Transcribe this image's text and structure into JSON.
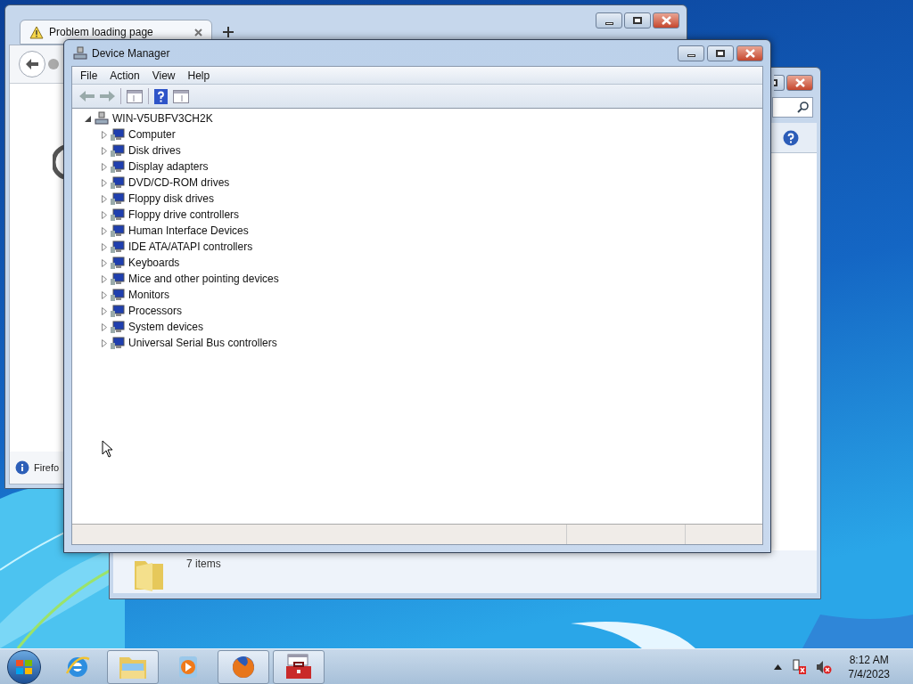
{
  "browser_window": {
    "tab_title": "Problem loading page",
    "status_text": "Firefo"
  },
  "explorer_window": {
    "status_text": "7 items"
  },
  "device_manager": {
    "title": "Device Manager",
    "menu": [
      "File",
      "Action",
      "View",
      "Help"
    ],
    "tree": {
      "label": "WIN-V5UBFV3CH2K",
      "expanded": true,
      "children": [
        {
          "label": "Computer",
          "expanded": false
        },
        {
          "label": "Disk drives",
          "expanded": false
        },
        {
          "label": "Display adapters",
          "expanded": false
        },
        {
          "label": "DVD/CD-ROM drives",
          "expanded": false
        },
        {
          "label": "Floppy disk drives",
          "expanded": false
        },
        {
          "label": "Floppy drive controllers",
          "expanded": false
        },
        {
          "label": "Human Interface Devices",
          "expanded": false
        },
        {
          "label": "IDE ATA/ATAPI controllers",
          "expanded": false
        },
        {
          "label": "Keyboards",
          "expanded": false
        },
        {
          "label": "Mice and other pointing devices",
          "expanded": false
        },
        {
          "label": "Monitors",
          "expanded": false
        },
        {
          "label": "Processors",
          "expanded": false
        },
        {
          "label": "System devices",
          "expanded": false
        },
        {
          "label": "Universal Serial Bus controllers",
          "expanded": false
        }
      ]
    }
  },
  "taskbar": {
    "buttons": [
      {
        "kind": "browser-e",
        "active": false
      },
      {
        "kind": "folder",
        "active": true
      },
      {
        "kind": "media",
        "active": false
      },
      {
        "kind": "firefox",
        "active": true
      },
      {
        "kind": "toolbox",
        "active": true
      }
    ],
    "clock": {
      "time": "8:12 AM",
      "date": "7/4/2023"
    }
  }
}
